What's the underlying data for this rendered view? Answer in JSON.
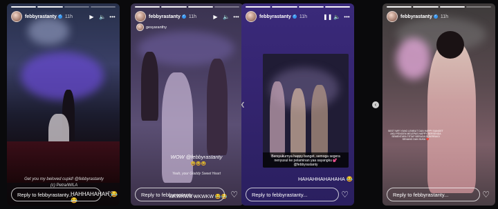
{
  "stories": [
    {
      "username": "febbyrastanty",
      "time": "11h",
      "reply_placeholder": "Reply to febbyrastanty...",
      "caption": "Get you my beloved cupid! @febbyrastanty",
      "caption2": "(c) Petra/WILA",
      "bottom_text": "HAHHAHAHAH 😂😂"
    },
    {
      "username": "febbyrastanty",
      "time": "11h",
      "reposted_user": "gesyaranthy",
      "reply_placeholder": "Reply to febbyrastanty...",
      "caption": "WOW @febbyrastanty",
      "emoji_line": "😆😆😆",
      "caption2": "Yeah, your Gladdy Sweet Heart",
      "bottom_text": "WKWKWK WKWKW 😂😂"
    },
    {
      "username": "febbyrastanty",
      "time": "11h",
      "reply_placeholder": "Reply to febbyrastanty...",
      "inner_caption": "Bersyukurnya happy banget, semoga segera nenyusul ke pelaminan yaa sayangku 💕 @febbyrastanty",
      "bottom_text": "HAHAHHAHAHAHA 😂"
    },
    {
      "username": "febbyrastanty",
      "time": "11h",
      "reply_placeholder": "Reply to febbyrastanty...",
      "small_caption": "BEST WIFI YANG LEMBUT DAN HAPPY BANGET AKU PENGEN MELEPAS HAPPY BERSENDA SEMENTARA TETAP BERADA DI BERBAGI SENANG DAN SUKA ❤️"
    }
  ],
  "icons": {
    "play": "play-icon",
    "volume": "volume-icon",
    "more": "more-icon",
    "pause": "pause-icon",
    "heart": "heart-icon",
    "nav_left": "chevron-left-icon",
    "nav_right": "chevron-left-icon"
  }
}
